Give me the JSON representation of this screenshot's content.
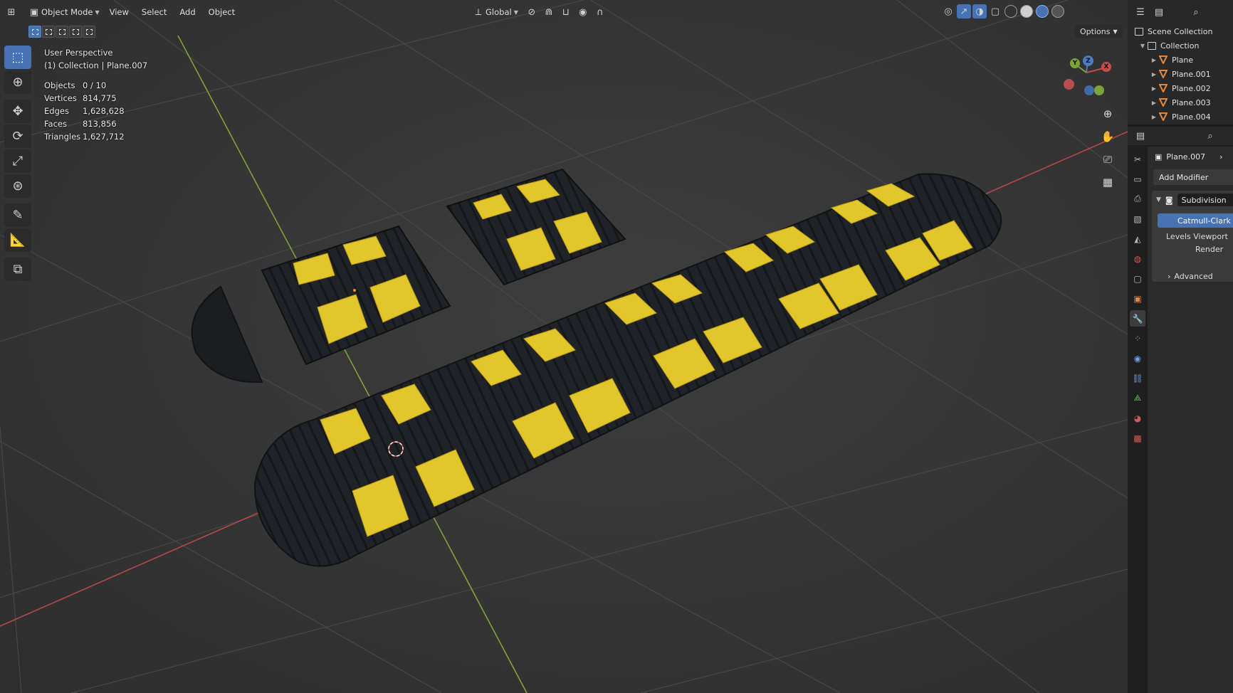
{
  "header": {
    "mode_label": "Object Mode",
    "menus": [
      "View",
      "Select",
      "Add",
      "Object"
    ],
    "orientation_label": "Global",
    "options_label": "Options"
  },
  "overlay": {
    "view_name": "User Perspective",
    "collection_line": "(1) Collection | Plane.007",
    "stats": [
      {
        "key": "Objects",
        "value": "0 / 10"
      },
      {
        "key": "Vertices",
        "value": "814,775"
      },
      {
        "key": "Edges",
        "value": "1,628,628"
      },
      {
        "key": "Faces",
        "value": "813,856"
      },
      {
        "key": "Triangles",
        "value": "1,627,712"
      }
    ]
  },
  "toolbar": {
    "tools": [
      "select-box-tool",
      "cursor-tool",
      "move-tool",
      "rotate-tool",
      "scale-tool",
      "transform-tool",
      "annotate-tool",
      "measure-tool",
      "add-cube-tool"
    ]
  },
  "gizmo": {
    "z": "Z",
    "y": "Y",
    "x": "X"
  },
  "outliner": {
    "scene_collection": "Scene Collection",
    "collection": "Collection",
    "objects": [
      "Plane",
      "Plane.001",
      "Plane.002",
      "Plane.003",
      "Plane.004"
    ]
  },
  "properties": {
    "object_name": "Plane.007",
    "add_modifier": "Add Modifier",
    "modifier_name": "Subdivision",
    "subdiv_type": "Catmull-Clark",
    "levels_viewport": "Levels Viewport",
    "render": "Render",
    "advanced": "Advanced"
  },
  "colors": {
    "accent": "#4772b3",
    "rubber": "#1f2226",
    "reflector": "#e3c52c",
    "x_axis": "#c94a4a",
    "y_axis": "#8bbf3a",
    "grid": "#454545"
  }
}
